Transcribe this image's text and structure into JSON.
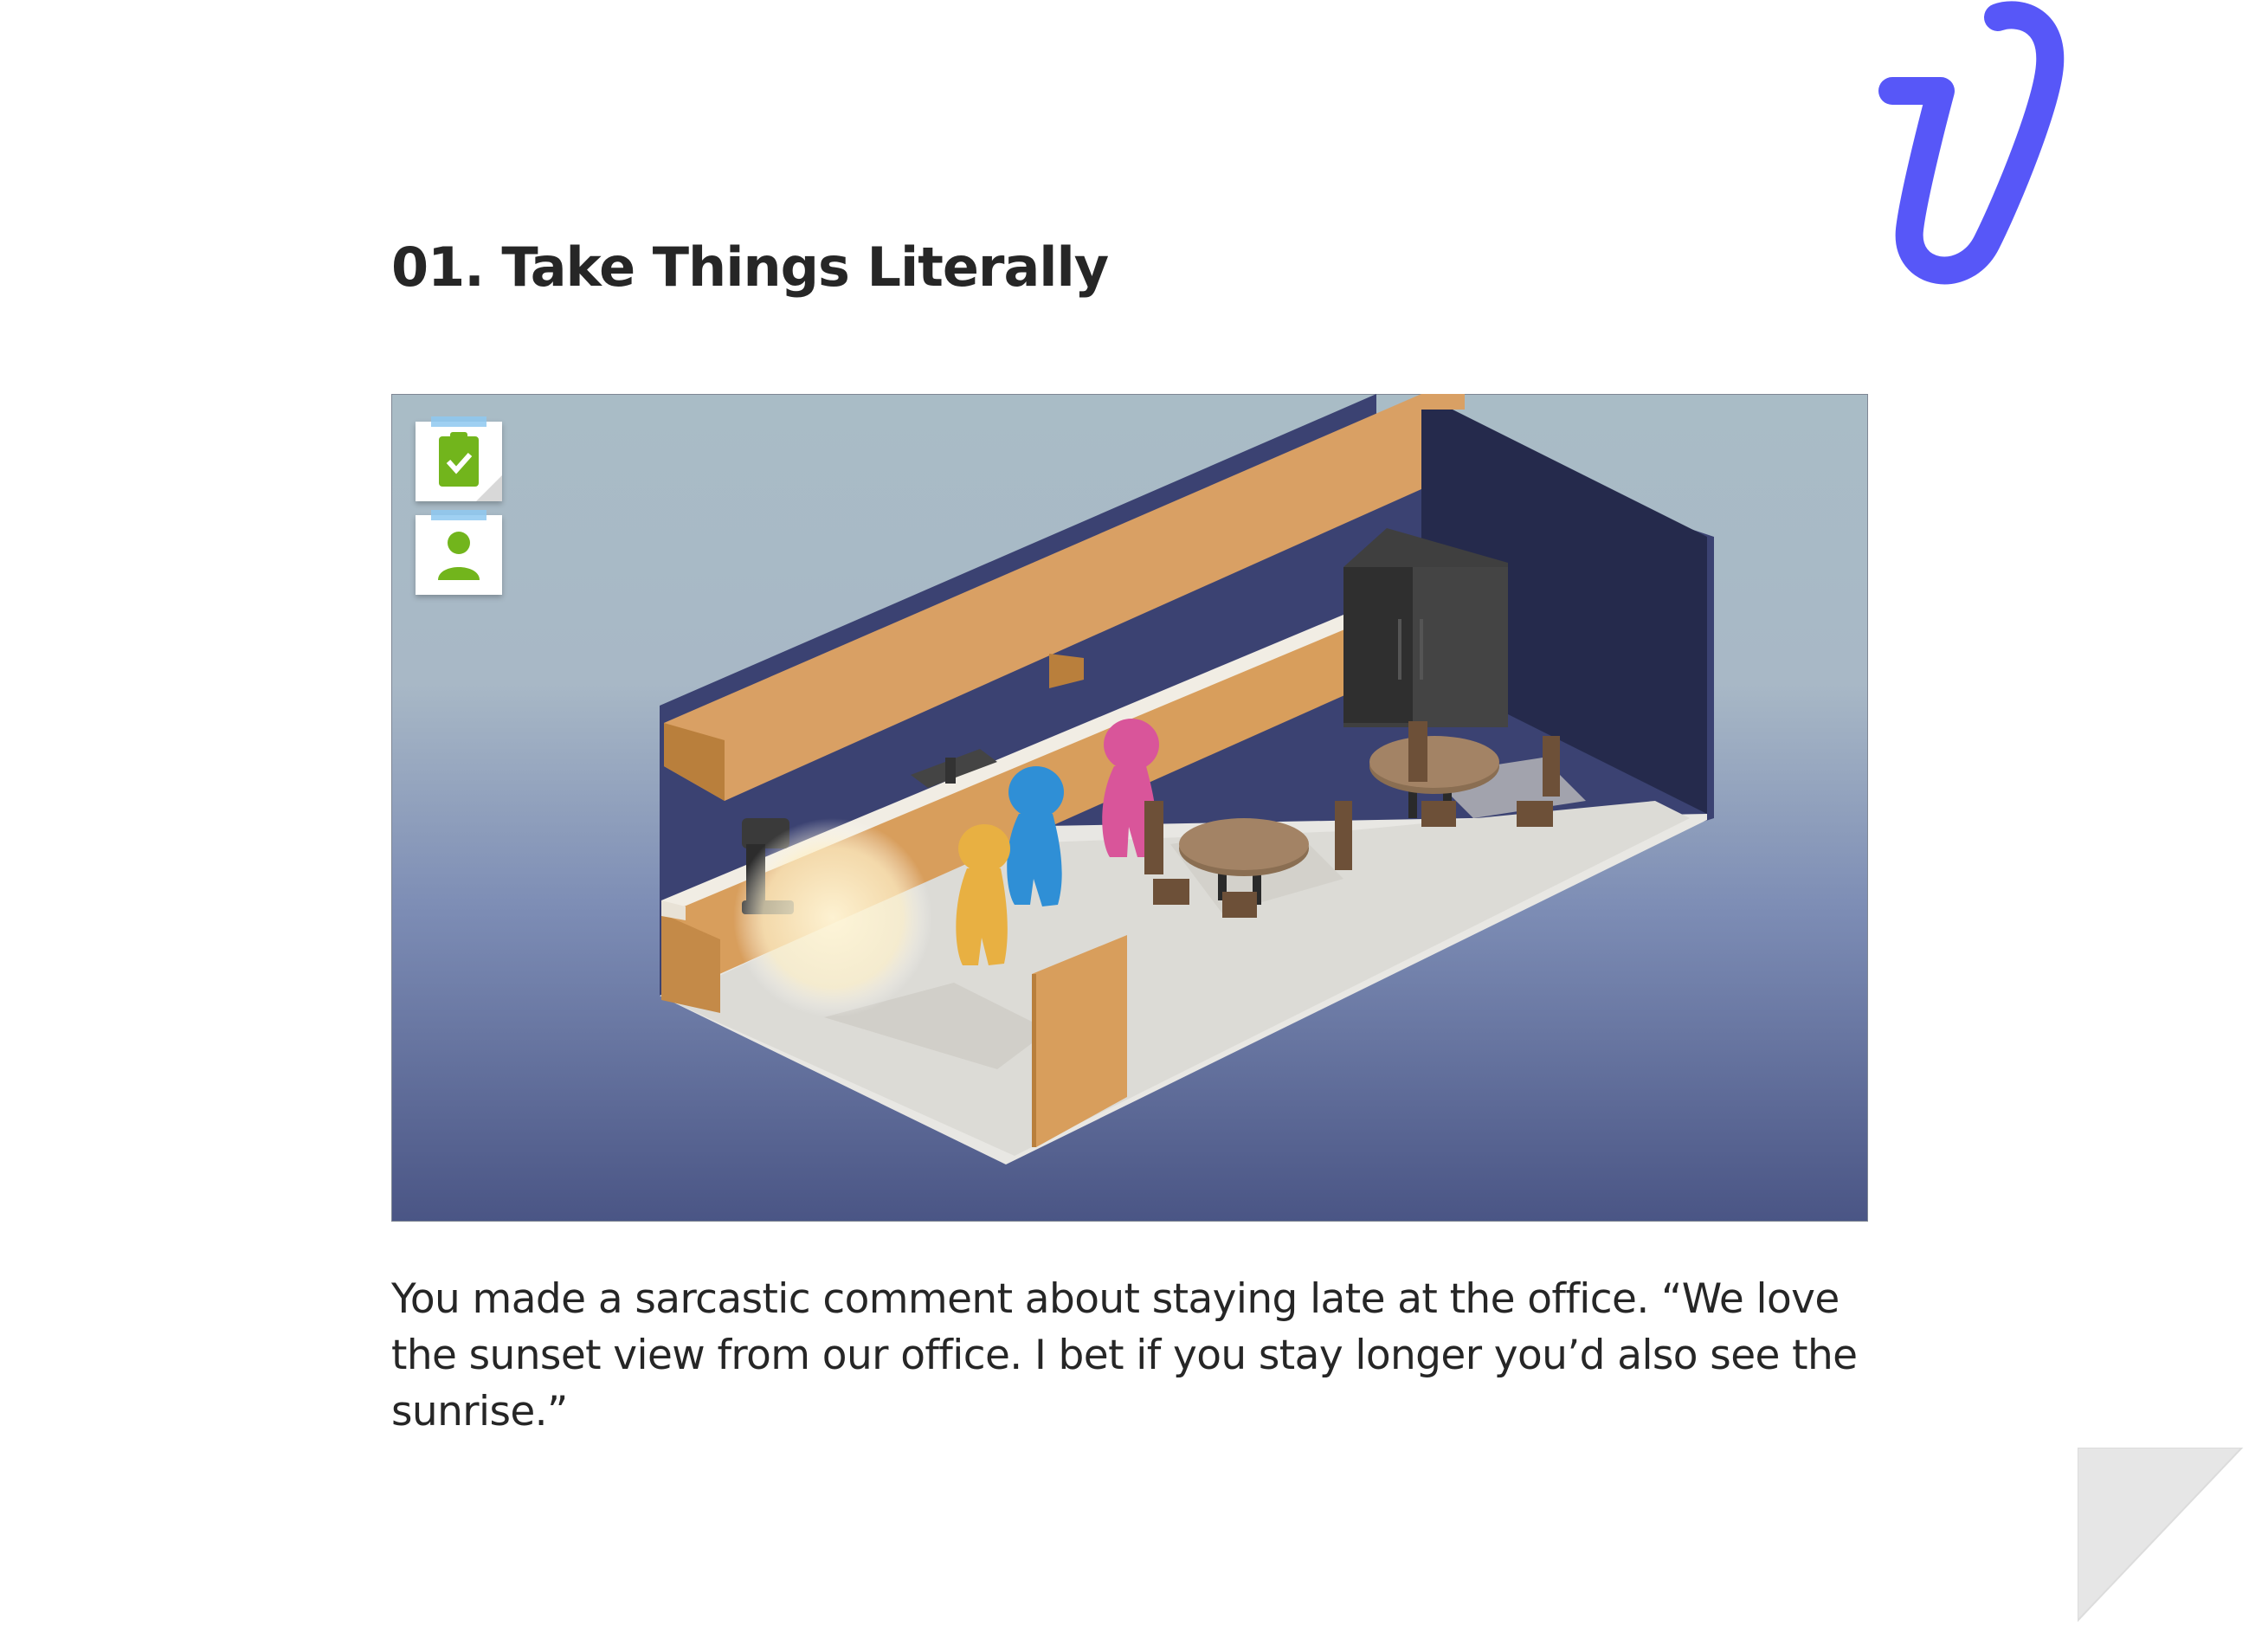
{
  "heading": {
    "title": "01. Take Things Literally"
  },
  "scene": {
    "characters": [
      {
        "name": "yellow",
        "color": "#e8b042"
      },
      {
        "name": "blue",
        "color": "#2f8fd6"
      },
      {
        "name": "pink",
        "color": "#d9559a"
      }
    ],
    "hud_icons": [
      "clipboard-check-icon",
      "person-icon"
    ],
    "accent_color": "#72b51c"
  },
  "body": {
    "caption": "You made a sarcastic comment about staying late at the office. “We love the sunset view from our office. I bet if you stay longer you’d also see the sunrise.”"
  },
  "colors": {
    "paperclip": "#5757f8",
    "background": "#ffffff"
  }
}
